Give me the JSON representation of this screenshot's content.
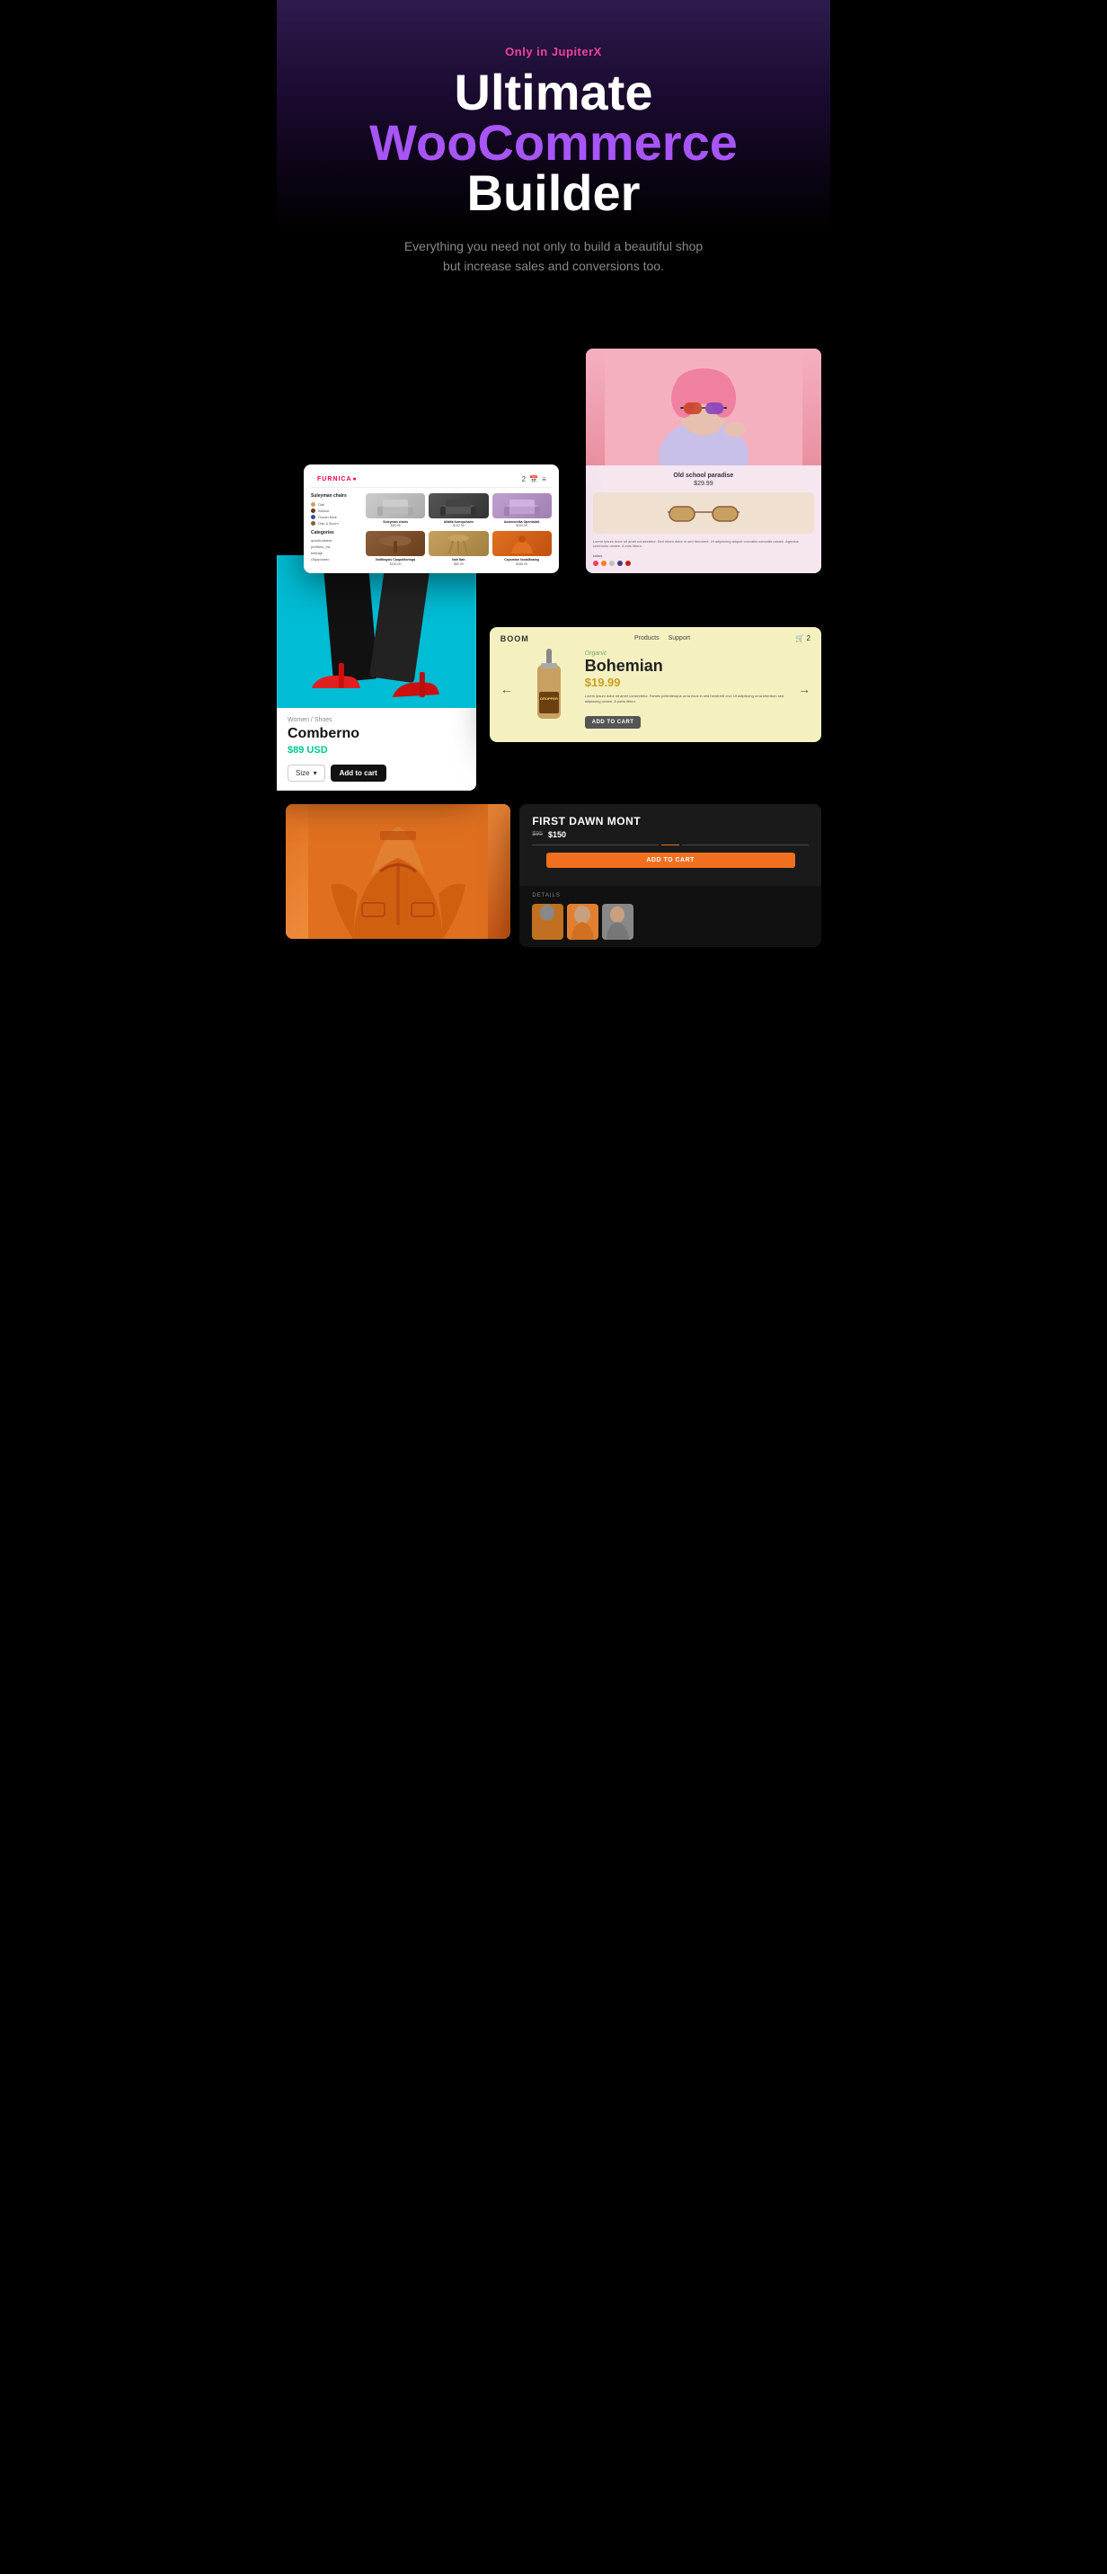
{
  "hero": {
    "badge": "Only in JupiterX",
    "title_line1": "Ultimate",
    "title_line2": "WooCommerce",
    "title_line3": "Builder",
    "subtitle": "Everything you need not only to build a beautiful shop but increase sales and conversions too."
  },
  "furniture_store": {
    "logo": "FURNICA",
    "category_title": "Suleyman chairs",
    "colors": [
      {
        "name": "Oak",
        "color": "#c8a060"
      },
      {
        "name": "Walnut",
        "color": "#6b3e1c"
      },
      {
        "name": "Ocean Blue",
        "color": "#3050a0"
      },
      {
        "name": "Oak & Boom",
        "color": "#8B5e3c"
      }
    ],
    "categories_title": "Categories",
    "categories": [
      "quicklooktest",
      "portfolio_fra",
      "beltraje",
      "Okjopodeto"
    ],
    "products": [
      {
        "name": "Suleyman chairs",
        "price": "$83.99"
      },
      {
        "name": "Alfalfa furnopchairs",
        "price": "$102.59"
      },
      {
        "name": "Assimontika Opentalalk",
        "price": "$200.99"
      },
      {
        "name": "Nottlingsis Coopotiloringa",
        "price": "$200.00"
      },
      {
        "name": "Nah Nah",
        "price": "$80.99"
      },
      {
        "name": "Cuysmion footalilnaing",
        "price": "$285.99"
      }
    ]
  },
  "pink_product": {
    "name": "Old school paradise",
    "price": "$29.99",
    "description": "Lorem ipsum dolor sit amet consectetur. Sed etiam dolor in sed hendrerit. Ut adipiscing aliquet convallis convallis ornare. Agentus commodo ornare. A euis libero.",
    "colors_label": "colors",
    "colors": [
      "#f04060",
      "#f08020",
      "#c0c0c0",
      "#404080",
      "#c02020"
    ]
  },
  "shoes_product": {
    "breadcrumb": "Women / Shoes",
    "name": "Comberno",
    "price": "$89 USD",
    "size_label": "Size",
    "add_to_cart": "Add to cart"
  },
  "bohemian_product": {
    "store_name": "BOOM",
    "nav_items": [
      "Products",
      "Support"
    ],
    "cart_count": "2",
    "tag": "Organic",
    "name": "Bohemian",
    "price": "$19.99",
    "description": "Lorem ipsum dolor sit amet consectetur. Fames pellentesque urna risus in sed hendrerit orci. Ut adipiscing urna interdum sed adipiscing ornare. A porta libero.",
    "button_label": "ADD TO CART",
    "dropper_label": "DROPPER"
  },
  "jacket_product": {
    "name": "FIRST DAWN MONT",
    "old_price": "$95",
    "new_price": "$150",
    "button_label": "ADD TO CART",
    "details_label": "DETAILS"
  }
}
